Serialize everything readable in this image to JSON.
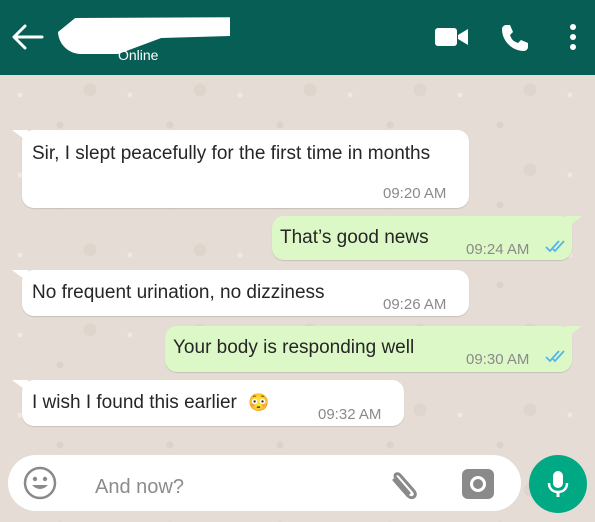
{
  "header": {
    "status": "Online",
    "icons": [
      "back-arrow-icon",
      "video-call-icon",
      "phone-call-icon",
      "more-options-icon"
    ],
    "color": "#075e54"
  },
  "messages": [
    {
      "direction": "incoming",
      "text": "Sir, I slept peacefully for the first time in months",
      "time": "09:20 AM"
    },
    {
      "direction": "outgoing",
      "text": "That’s good news",
      "time": "09:24 AM",
      "status": "read"
    },
    {
      "direction": "incoming",
      "text": "No frequent urination, no dizziness",
      "time": "09:26 AM"
    },
    {
      "direction": "outgoing",
      "text": "Your body is responding well",
      "time": "09:30 AM",
      "status": "read"
    },
    {
      "direction": "incoming",
      "text": "I wish I found this earlier",
      "emoji": "😳",
      "time": "09:32 AM"
    }
  ],
  "composer": {
    "placeholder": "And now?",
    "icons": [
      "emoji-icon",
      "attach-icon",
      "camera-icon",
      "mic-icon"
    ],
    "send_color": "#00a884"
  }
}
